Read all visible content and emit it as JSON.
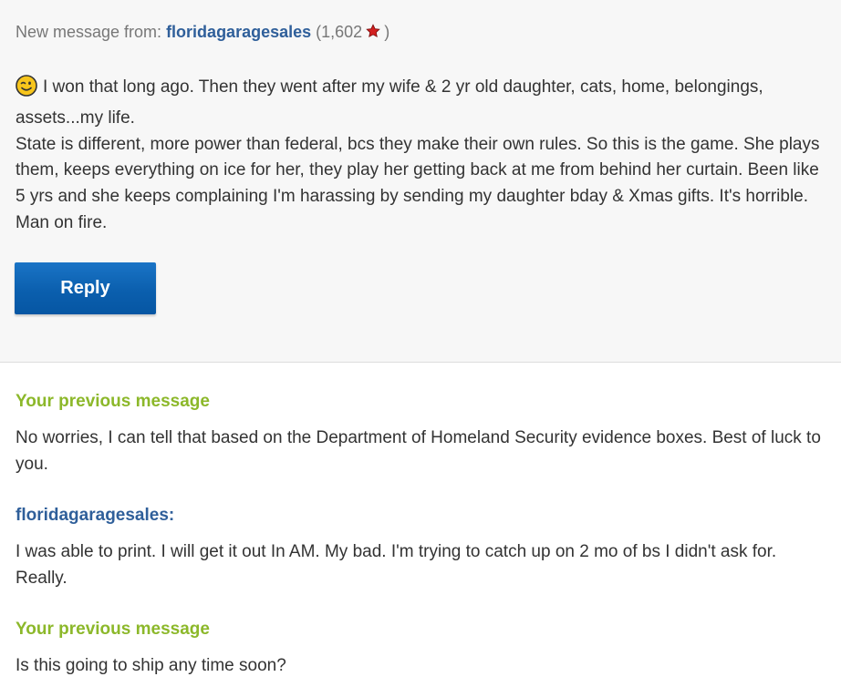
{
  "header": {
    "prefix": "New message from: ",
    "sender": "floridagaragesales",
    "rating_open": "(1,602",
    "rating_close": ")",
    "star_icon": "red-star-icon",
    "star_color": "#d21f1f"
  },
  "message": {
    "emoji": "winking-face-icon",
    "paragraph_1": "I won that long ago. Then they went after my wife & 2 yr old daughter, cats, home, belongings, assets...my life.",
    "paragraph_2": "State is different, more power than federal, bcs they make their own rules. So this is the game. She plays them, keeps everything on ice for her, they play her getting back at me from behind her curtain. Been like 5 yrs and she keeps complaining I'm harassing by sending my daughter bday & Xmas gifts. It's horrible. Man on fire."
  },
  "reply_button": {
    "label": "Reply"
  },
  "thread": [
    {
      "author": "Your previous message",
      "text": "No worries, I can tell that based on the Department of Homeland Security evidence boxes. Best of luck to you."
    },
    {
      "author": "floridagaragesales:",
      "text": "I was able to print. I will get it out In AM. My bad. I'm trying to catch up on 2 mo of bs I didn't ask for. Really."
    },
    {
      "author": "Your previous message",
      "text": "Is this going to ship any time soon?"
    }
  ],
  "colors": {
    "link_blue": "#2f5f9a",
    "self_green": "#8cb82a",
    "button_blue": "#0b5fae",
    "panel_bg": "#f7f7f7"
  }
}
